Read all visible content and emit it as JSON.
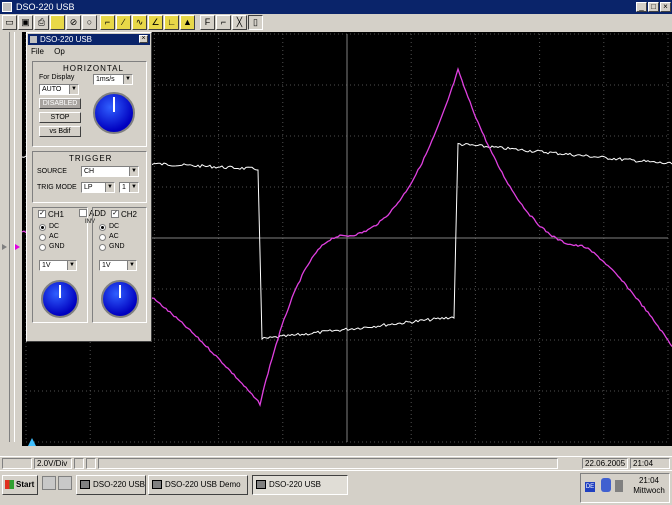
{
  "window": {
    "title": "DSO-220 USB"
  },
  "toolbar": {
    "icons": [
      "open-icon",
      "save-icon",
      "print-icon",
      "folder-icon",
      "stop-icon",
      "zoom-icon",
      "slope-rise-icon",
      "slope-fall-icon",
      "slope-both-icon",
      "marker-icon",
      "cursor-icon",
      "freq-icon",
      "math-icon",
      "trigger-icon",
      "channel-icon",
      "info-icon"
    ]
  },
  "panel": {
    "title": "DSO-220 USB",
    "menu": [
      "File",
      "Op"
    ],
    "horizontal": {
      "title": "HORIZONTAL",
      "for_display_label": "For Display",
      "mode_value": "AUTO",
      "timebase_value": "1ms/s",
      "btn_disabled": "DISABLED",
      "btn_stop": "STOP",
      "btn_vs": "vs Bdif"
    },
    "trigger": {
      "title": "TRIGGER",
      "source_label": "SOURCE",
      "source_value": "CH",
      "mode_label": "TRIG MODE",
      "mode_value": "LP",
      "edge_value": "1"
    },
    "channels": {
      "ch1_label": "CH1",
      "add_label": "ADD",
      "ch2_label": "CH2",
      "inv_label": "INV",
      "coupling": [
        "DC",
        "AC",
        "GND"
      ],
      "ch1_volts": "1V",
      "ch2_volts": "1V"
    }
  },
  "statusbar": {
    "fields": [
      "",
      "2.0V/Div",
      "",
      "",
      "",
      ""
    ],
    "date": "22.06.2005",
    "time": "21:04"
  },
  "taskbar": {
    "start_label": "Start",
    "tasks": [
      "DSO-220 USB",
      "DSO-220 USB Demo",
      "DSO-220 USB"
    ],
    "tray_time": "21:04",
    "tray_day": "Mittwoch"
  }
}
